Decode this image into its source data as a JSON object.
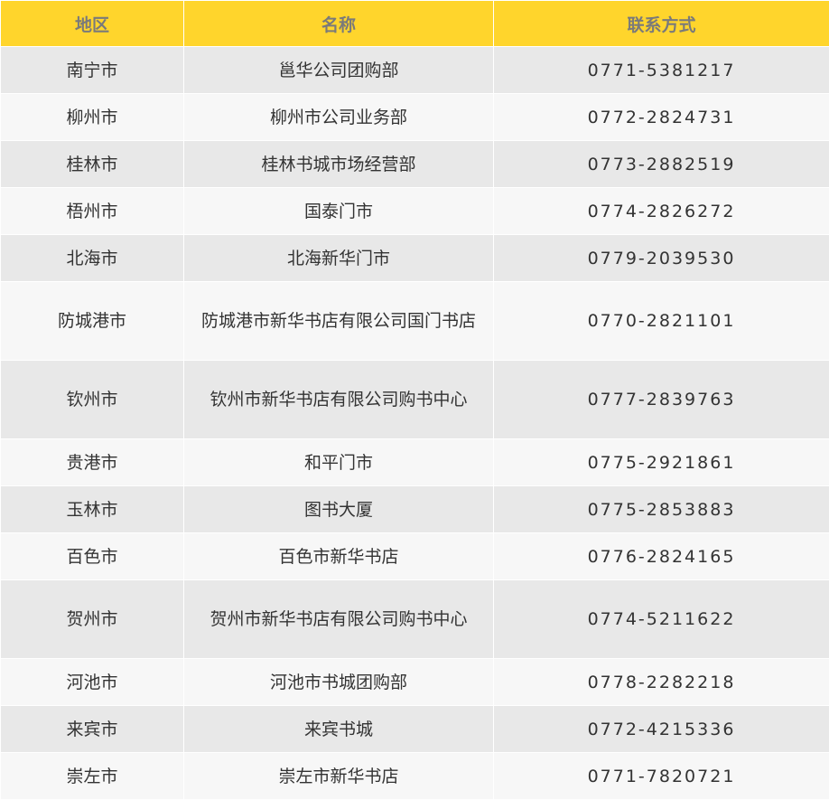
{
  "table": {
    "headers": [
      "地区",
      "名称",
      "联系方式"
    ],
    "rows": [
      {
        "region": "南宁市",
        "name": "邕华公司团购部",
        "contact": "0771-5381217"
      },
      {
        "region": "柳州市",
        "name": "柳州市公司业务部",
        "contact": "0772-2824731"
      },
      {
        "region": "桂林市",
        "name": "桂林书城市场经营部",
        "contact": "0773-2882519"
      },
      {
        "region": "梧州市",
        "name": "国泰门市",
        "contact": "0774-2826272"
      },
      {
        "region": "北海市",
        "name": "北海新华门市",
        "contact": "0779-2039530"
      },
      {
        "region": "防城港市",
        "name": "防城港市新华书店有限公司国门书店",
        "contact": "0770-2821101"
      },
      {
        "region": "钦州市",
        "name": "钦州市新华书店有限公司购书中心",
        "contact": "0777-2839763"
      },
      {
        "region": "贵港市",
        "name": "和平门市",
        "contact": "0775-2921861"
      },
      {
        "region": "玉林市",
        "name": "图书大厦",
        "contact": "0775-2853883"
      },
      {
        "region": "百色市",
        "name": "百色市新华书店",
        "contact": "0776-2824165"
      },
      {
        "region": "贺州市",
        "name": "贺州市新华书店有限公司购书中心",
        "contact": "0774-5211622"
      },
      {
        "region": "河池市",
        "name": "河池市书城团购部",
        "contact": "0778-2282218"
      },
      {
        "region": "来宾市",
        "name": "来宾书城",
        "contact": "0772-4215336"
      },
      {
        "region": "崇左市",
        "name": "崇左市新华书店",
        "contact": "0771-7820721"
      }
    ]
  },
  "colors": {
    "header_bg": "#ffd52c",
    "header_text": "#7a7a7a",
    "row_odd": "#e8e8e8",
    "row_even": "#f7f7f7"
  }
}
